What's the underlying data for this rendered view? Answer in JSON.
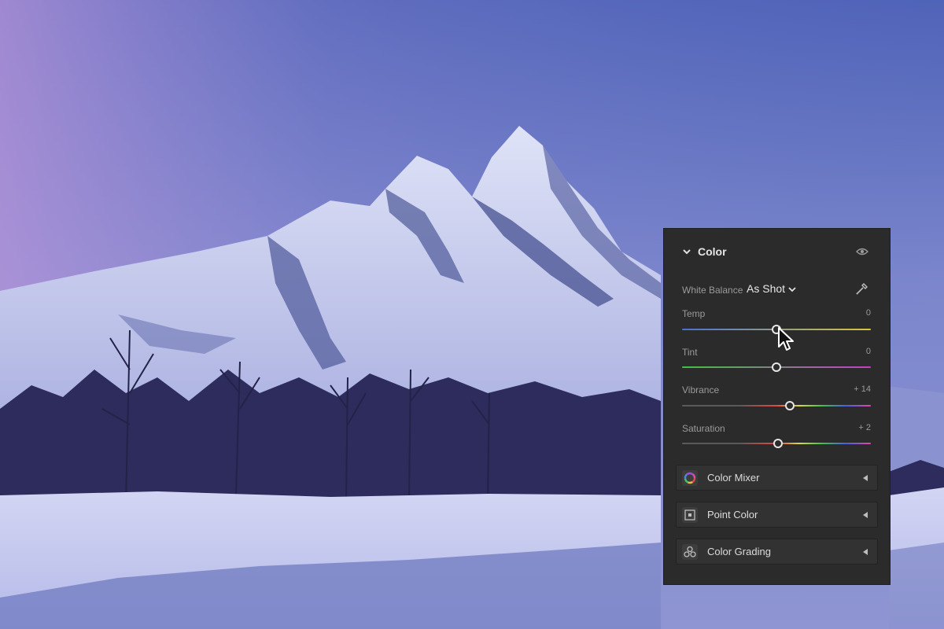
{
  "photo": {
    "sky_top": "#5b6cbf",
    "sky_mid": "#7a82c9",
    "mountain_snow": "#d6dcf4",
    "mountain_shadow": "#4a5492",
    "forest": "#2a2a58",
    "snow_ground": "#c9cdf0"
  },
  "panel": {
    "title": "Color",
    "icons": {
      "collapse": "chevron-down-icon",
      "visibility": "eye-icon"
    },
    "white_balance": {
      "label": "White Balance",
      "value": "As Shot",
      "dropdown_icon": "chevron-down-icon",
      "picker_icon": "eyedropper-icon"
    },
    "sliders": [
      {
        "label": "Temp",
        "value": "0",
        "position": 0.5,
        "track_from": "#4b6fd6",
        "track_to": "#d6c83a"
      },
      {
        "label": "Tint",
        "value": "0",
        "position": 0.5,
        "track_from": "#3cc443",
        "track_to": "#c63ec6"
      },
      {
        "label": "Vibrance",
        "value": "+ 14",
        "position": 0.57,
        "track_from": "#6a6a6a",
        "track_to": "rainbow"
      },
      {
        "label": "Saturation",
        "value": "+ 2",
        "position": 0.51,
        "track_from": "#6a6a6a",
        "track_to": "rainbow"
      }
    ],
    "sub_panels": [
      {
        "label": "Color Mixer",
        "icon": "color-wheel-icon"
      },
      {
        "label": "Point Color",
        "icon": "point-color-icon"
      },
      {
        "label": "Color Grading",
        "icon": "color-grading-icon"
      }
    ]
  }
}
